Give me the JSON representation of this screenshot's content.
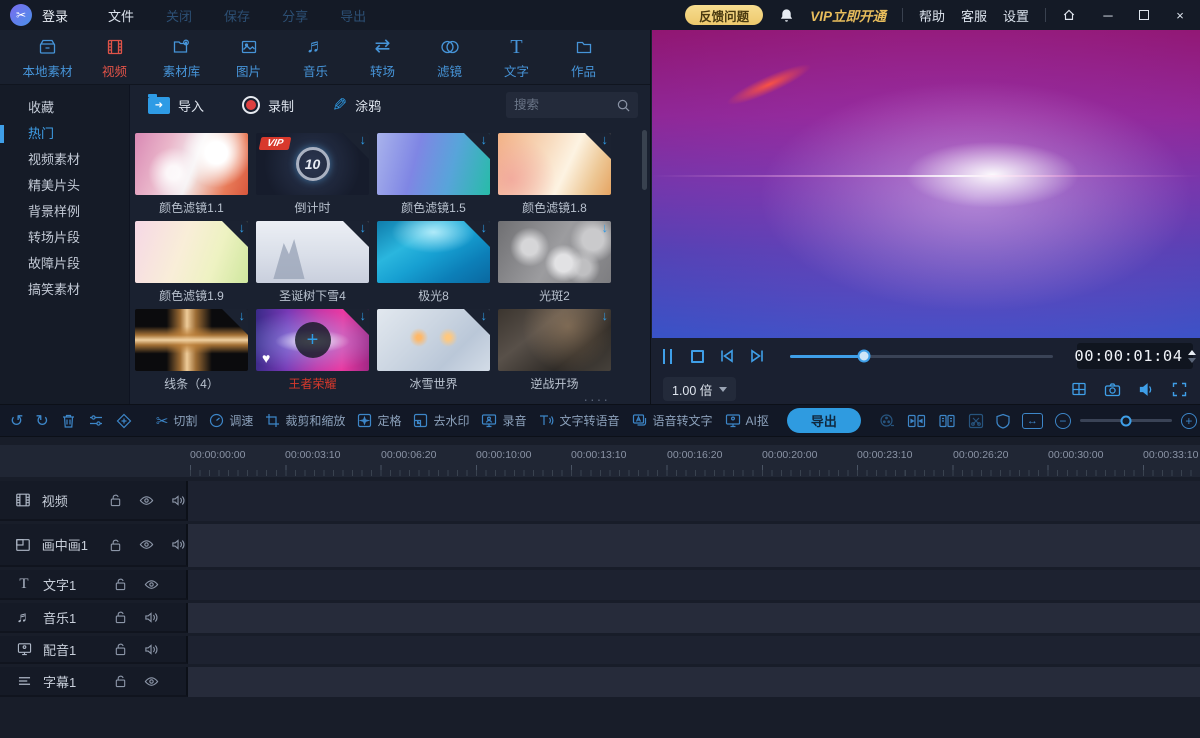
{
  "titlebar": {
    "login": "登录",
    "menu": [
      "文件",
      "关闭",
      "保存",
      "分享",
      "导出"
    ],
    "feedback": "反馈问题",
    "vip": "VIP立即开通",
    "links": [
      "帮助",
      "客服",
      "设置"
    ]
  },
  "tabs": [
    {
      "label": "本地素材"
    },
    {
      "label": "视频",
      "active": true
    },
    {
      "label": "素材库"
    },
    {
      "label": "图片"
    },
    {
      "label": "音乐"
    },
    {
      "label": "转场"
    },
    {
      "label": "滤镜"
    },
    {
      "label": "文字"
    },
    {
      "label": "作品"
    }
  ],
  "sidebar": {
    "items": [
      "收藏",
      "热门",
      "视频素材",
      "精美片头",
      "背景样例",
      "转场片段",
      "故障片段",
      "搞笑素材"
    ],
    "active": "热门"
  },
  "media_toolbar": {
    "import": "导入",
    "record": "录制",
    "doodle": "涂鸦",
    "search_placeholder": "搜索"
  },
  "materials": [
    {
      "label": "颜色滤镜1.1"
    },
    {
      "label": "倒计时",
      "vip_badge": "VIP",
      "center_text": "10"
    },
    {
      "label": "颜色滤镜1.5"
    },
    {
      "label": "颜色滤镜1.8"
    },
    {
      "label": "颜色滤镜1.9"
    },
    {
      "label": "圣诞树下雪4"
    },
    {
      "label": "极光8"
    },
    {
      "label": "光斑2"
    },
    {
      "label": "线条（4）"
    },
    {
      "label": "王者荣耀",
      "selected": true,
      "favorited": true
    },
    {
      "label": "冰雪世界"
    },
    {
      "label": "逆战开场"
    }
  ],
  "preview": {
    "timecode": "00:00:01:04",
    "speed": "1.00 倍"
  },
  "toolbar": {
    "tools": [
      "切割",
      "调速",
      "裁剪和缩放",
      "定格",
      "去水印",
      "录音",
      "文字转语音",
      "语音转文字",
      "AI抠"
    ],
    "export_label": "导出"
  },
  "timeline": {
    "ruler": [
      "00:00:00:00",
      "00:00:03:10",
      "00:00:06:20",
      "00:00:10:00",
      "00:00:13:10",
      "00:00:16:20",
      "00:00:20:00",
      "00:00:23:10",
      "00:00:26:20",
      "00:00:30:00",
      "00:00:33:10"
    ],
    "tracks": [
      {
        "label": "视频"
      },
      {
        "label": "画中画1"
      },
      {
        "label": "文字1"
      },
      {
        "label": "音乐1"
      },
      {
        "label": "配音1"
      },
      {
        "label": "字幕1"
      }
    ]
  },
  "ui": {
    "resize_dots": "····"
  },
  "colors": {
    "accent": "#3f9fe8",
    "active_tab": "#e05348",
    "vip_gold": "#e8bd5c",
    "feedback_bg": "#f2d583",
    "record_red": "#de4040",
    "selected_label_red": "#d8392c",
    "export_btn": "#2f9be0"
  }
}
